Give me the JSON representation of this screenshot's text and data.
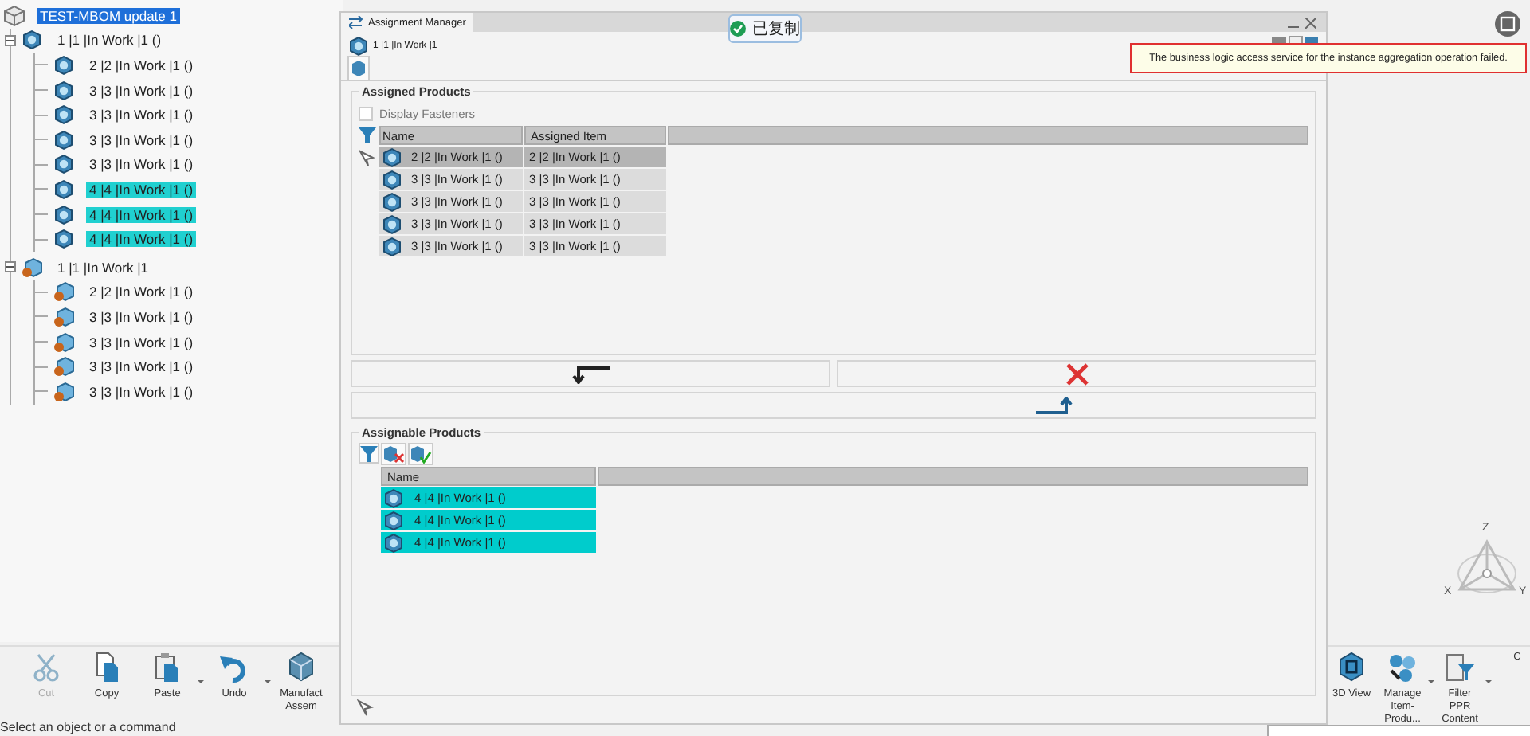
{
  "tree": {
    "label": "TEST-MBOM update 1",
    "selected": true,
    "kind": "root",
    "children": [
      {
        "label": "1 |1 |In Work |1 ()",
        "selected": false,
        "highlighted": false,
        "kind": "product",
        "expanded": true,
        "children": [
          {
            "label": "2 |2 |In Work |1 ()",
            "selected": false,
            "highlighted": false,
            "kind": "product"
          },
          {
            "label": "3 |3 |In Work |1 ()",
            "selected": false,
            "highlighted": false,
            "kind": "product"
          },
          {
            "label": "3 |3 |In Work |1 ()",
            "selected": false,
            "highlighted": false,
            "kind": "product"
          },
          {
            "label": "3 |3 |In Work |1 ()",
            "selected": false,
            "highlighted": false,
            "kind": "product"
          },
          {
            "label": "3 |3 |In Work |1 ()",
            "selected": false,
            "highlighted": false,
            "kind": "product"
          },
          {
            "label": "4 |4 |In Work |1 ()",
            "selected": false,
            "highlighted": true,
            "kind": "product"
          },
          {
            "label": "4 |4 |In Work |1 ()",
            "selected": false,
            "highlighted": true,
            "kind": "product"
          },
          {
            "label": "4 |4 |In Work |1 ()",
            "selected": false,
            "highlighted": true,
            "kind": "product"
          }
        ]
      },
      {
        "label": "1 |1 |In Work |1",
        "selected": false,
        "highlighted": false,
        "kind": "assembly",
        "expanded": true,
        "children": [
          {
            "label": "2 |2 |In Work |1 ()",
            "selected": false,
            "highlighted": false,
            "kind": "assembly"
          },
          {
            "label": "3 |3 |In Work |1 ()",
            "selected": false,
            "highlighted": false,
            "kind": "assembly"
          },
          {
            "label": "3 |3 |In Work |1 ()",
            "selected": false,
            "highlighted": false,
            "kind": "assembly"
          },
          {
            "label": "3 |3 |In Work |1 ()",
            "selected": false,
            "highlighted": false,
            "kind": "assembly"
          },
          {
            "label": "3 |3 |In Work |1 ()",
            "selected": false,
            "highlighted": false,
            "kind": "assembly"
          }
        ]
      }
    ]
  },
  "toolbar_left": [
    {
      "label": "Cut",
      "kind": "cut",
      "disabled": true,
      "dropdown": false
    },
    {
      "label": "Copy",
      "kind": "copy",
      "disabled": false,
      "dropdown": false
    },
    {
      "label": "Paste",
      "kind": "paste",
      "disabled": false,
      "dropdown": true
    },
    {
      "label": "Undo",
      "kind": "undo",
      "disabled": false,
      "dropdown": true
    },
    {
      "label": "Manufact Assem",
      "kind": "assembly",
      "disabled": false,
      "dropdown": false
    }
  ],
  "toolbar_right": [
    {
      "label": "3D View",
      "kind": "view3d",
      "disabled": false,
      "dropdown": false
    },
    {
      "label": "Manage Item-Produ...",
      "kind": "manage",
      "disabled": false,
      "dropdown": true
    },
    {
      "label": "Filter PPR Content",
      "kind": "filter",
      "disabled": false,
      "dropdown": true
    },
    {
      "label": "C",
      "kind": "cut-off",
      "disabled": false,
      "dropdown": false
    }
  ],
  "compass": {
    "z": "Z",
    "x": "X",
    "y": "Y"
  },
  "status_bar": {
    "text": "Select an object or a command"
  },
  "dialog": {
    "title": "Assignment Manager",
    "object": "1 |1 |In Work |1",
    "assigned": {
      "title": "Assigned Products",
      "display_fasteners": {
        "label": "Display Fasteners",
        "checked": false,
        "disabled": true
      },
      "columns": [
        "Name",
        "Assigned Item"
      ],
      "rows": [
        {
          "name": "2 |2 |In Work |1 ()",
          "assigned_item": "2 |2 |In Work |1 ()",
          "selected": true
        },
        {
          "name": "3 |3 |In Work |1 ()",
          "assigned_item": "3 |3 |In Work |1 ()",
          "selected": false
        },
        {
          "name": "3 |3 |In Work |1 ()",
          "assigned_item": "3 |3 |In Work |1 ()",
          "selected": false
        },
        {
          "name": "3 |3 |In Work |1 ()",
          "assigned_item": "3 |3 |In Work |1 ()",
          "selected": false
        },
        {
          "name": "3 |3 |In Work |1 ()",
          "assigned_item": "3 |3 |In Work |1 ()",
          "selected": false
        }
      ]
    },
    "assignable": {
      "title": "Assignable Products",
      "columns": [
        "Name"
      ],
      "rows": [
        {
          "name": "4 |4 |In Work |1 ()",
          "selected": false,
          "highlighted": true
        },
        {
          "name": "4 |4 |In Work |1 ()",
          "selected": false,
          "highlighted": true
        },
        {
          "name": "4 |4 |In Work |1 ()",
          "selected": false,
          "highlighted": true
        }
      ]
    }
  },
  "toast": {
    "text": "已复制"
  },
  "tooltip": {
    "text": "The business logic access service for the instance aggregation operation failed."
  }
}
